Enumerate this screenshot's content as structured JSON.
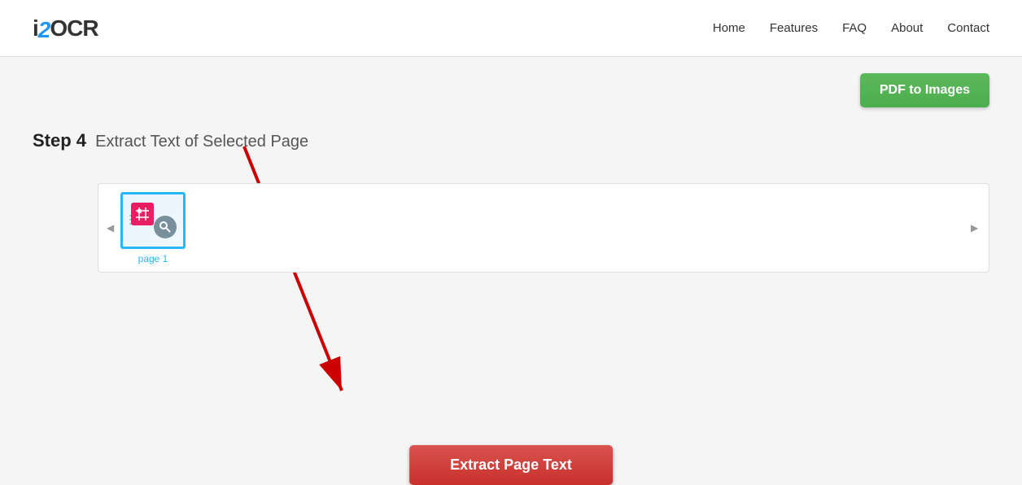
{
  "header": {
    "logo": {
      "i": "i",
      "two": "2",
      "ocr": "OCR"
    },
    "nav": {
      "items": [
        {
          "label": "Home",
          "id": "home"
        },
        {
          "label": "Features",
          "id": "features"
        },
        {
          "label": "FAQ",
          "id": "faq"
        },
        {
          "label": "About",
          "id": "about"
        },
        {
          "label": "Contact",
          "id": "contact"
        }
      ]
    }
  },
  "main": {
    "pdf_to_images_btn": "PDF to Images",
    "step4": {
      "label": "Step 4",
      "description": "Extract Text of Selected Page"
    },
    "page_thumbnail": {
      "label": "page 1"
    },
    "extract_btn": "Extract Page Text",
    "scroll_left": "◀",
    "scroll_right": "▶"
  },
  "icons": {
    "crop": "⊞",
    "search": "🔍"
  }
}
